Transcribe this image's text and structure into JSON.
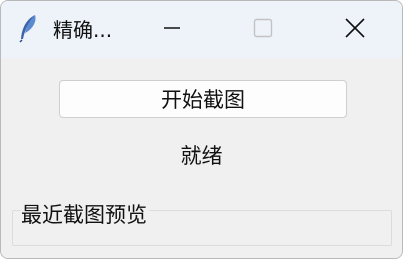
{
  "window": {
    "title": "精确...",
    "icon": "feather-icon",
    "controls": {
      "minimize": "minimize-icon",
      "maximize": "maximize-icon",
      "close": "close-icon"
    }
  },
  "main": {
    "start_button_label": "开始截图",
    "status_text": "就绪",
    "preview_label": "最近截图预览"
  }
}
